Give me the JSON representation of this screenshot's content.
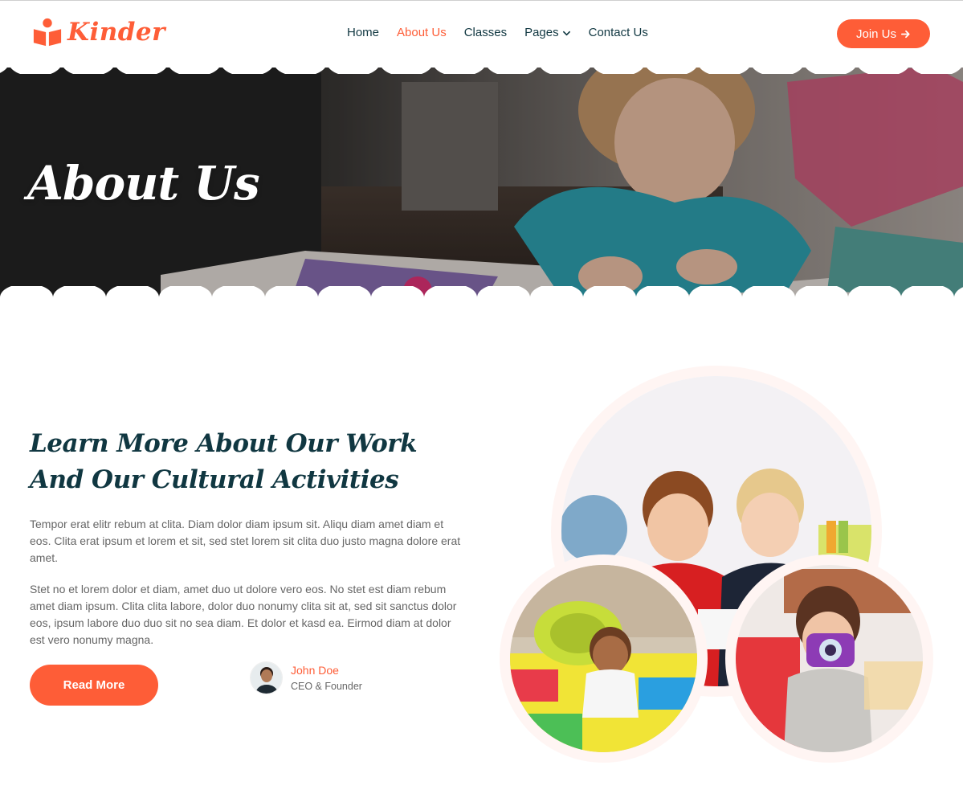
{
  "brand": {
    "name": "Kinder",
    "icon": "book-reader-icon",
    "color": "#FE5D37"
  },
  "nav": {
    "items": [
      {
        "label": "Home",
        "active": false
      },
      {
        "label": "About Us",
        "active": true
      },
      {
        "label": "Classes",
        "active": false
      },
      {
        "label": "Pages",
        "active": false,
        "dropdown": true
      },
      {
        "label": "Contact Us",
        "active": false
      }
    ],
    "join_label": "Join Us"
  },
  "hero": {
    "title": "About Us"
  },
  "about": {
    "title": "Learn More About Our Work And Our Cultural Activities",
    "paragraph1": "Tempor erat elitr rebum at clita. Diam dolor diam ipsum sit. Aliqu diam amet diam et eos. Clita erat ipsum et lorem et sit, sed stet lorem sit clita duo justo magna dolore erat amet.",
    "paragraph2": "Stet no et lorem dolor et diam, amet duo ut dolore vero eos. No stet est diam rebum amet diam ipsum. Clita clita labore, dolor duo nonumy clita sit at, sed sit sanctus dolor eos, ipsum labore duo duo sit no sea diam. Et dolor et kasd ea. Eirmod diam at dolor est vero nonumy magna.",
    "read_more_label": "Read More",
    "founder": {
      "name": "John Doe",
      "role": "CEO & Founder"
    }
  },
  "colors": {
    "primary": "#FE5D37",
    "dark": "#103741",
    "light": "#FFF5F3",
    "text": "#666666"
  }
}
